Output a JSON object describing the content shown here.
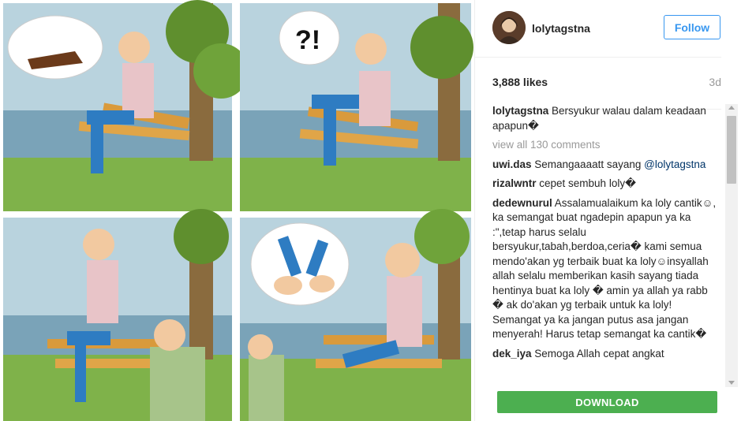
{
  "post": {
    "username": "lolytagstna",
    "follow_label": "Follow",
    "likes": "3,888 likes",
    "time": "3d",
    "caption_user": "lolytagstna",
    "caption_text": " Bersyukur walau dalam keadaan apapun�",
    "view_all": "view all 130 comments"
  },
  "comments": [
    {
      "user": "uwi.das",
      "text": " Semangaaaatt sayang ",
      "mention": "@lolytagstna"
    },
    {
      "user": "rizalwntr",
      "text": " cepet sembuh loly�",
      "mention": ""
    },
    {
      "user": "dedewnurul",
      "text": " Assalamualaikum ka loly cantik☺, ka semangat buat ngadepin apapun ya ka :\",tetap harus selalu bersyukur,tabah,berdoa,ceria� kami semua mendo'akan yg terbaik buat ka loly☺insyallah allah selalu memberikan kasih sayang tiada hentinya buat ka loly � amin ya allah ya rabb � ak do'akan yg terbaik untuk ka loly! Semangat ya ka jangan putus asa jangan menyerah! Harus tetap semangat ka cantik�",
      "mention": ""
    },
    {
      "user": "dek_iya",
      "text": " Semoga Allah cepat angkat",
      "mention": ""
    }
  ],
  "download_label": "DOWNLOAD",
  "image": {
    "panel2_bubble_text": "?!"
  },
  "colors": {
    "follow": "#3897f0",
    "download": "#4caf50",
    "mention": "#003569"
  }
}
